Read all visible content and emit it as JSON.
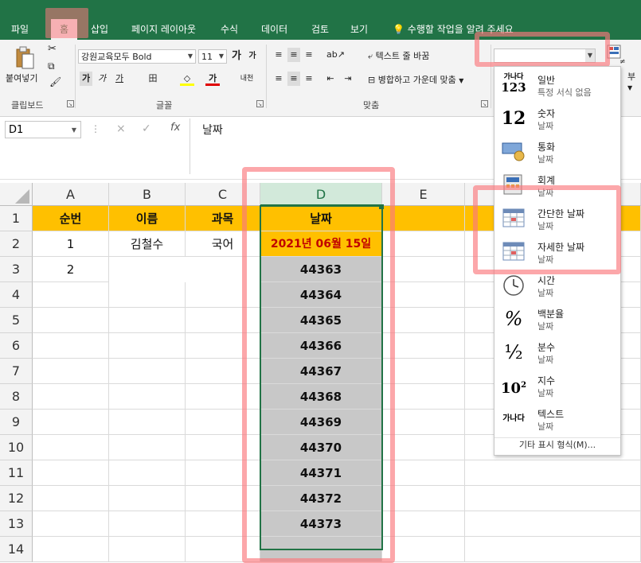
{
  "ribbon_tabs": [
    "파일",
    "홈",
    "삽입",
    "페이지 레이아웃",
    "수식",
    "데이터",
    "검토",
    "보기"
  ],
  "tell_me": "수행할 작업을 알려 주세요",
  "clipboard": {
    "paste_label": "붙여넣기",
    "group_label": "클립보드"
  },
  "font": {
    "name": "강원교육모두 Bold",
    "size": "11",
    "grow": "가",
    "shrink": "가",
    "bold": "가",
    "italic": "가",
    "underline": "가",
    "border": "田",
    "fill": "◇",
    "font_color": "가",
    "phonetic": "내천",
    "group_label": "글꼴"
  },
  "alignment": {
    "wrap_text": "텍스트 줄 바꿈",
    "merge_center": "병합하고 가운데 맞춤",
    "group_label": "맞춤"
  },
  "number_format": {
    "value": ""
  },
  "formula_bar": {
    "name_box": "D1",
    "cancel": "×",
    "enter": "✓",
    "fx": "fx",
    "content": "날짜"
  },
  "columns": [
    "A",
    "B",
    "C",
    "D",
    "E"
  ],
  "rows": [
    "1",
    "2",
    "3",
    "4",
    "5",
    "6",
    "7",
    "8",
    "9",
    "10",
    "11",
    "12",
    "13",
    "14"
  ],
  "header_row": {
    "a": "순번",
    "b": "이름",
    "c": "과목",
    "d": "날짜"
  },
  "row2": {
    "a": "1",
    "b": "김철수",
    "c": "국어",
    "d": "2021년 06월 15일"
  },
  "row3": {
    "a": "2"
  },
  "d_values": [
    "44363",
    "44364",
    "44365",
    "44366",
    "44367",
    "44368",
    "44369",
    "44370",
    "44371",
    "44372",
    "44373"
  ],
  "format_menu": {
    "items": [
      {
        "icon": "가나다 123",
        "name": "일반",
        "sub": "특정 서식 없음"
      },
      {
        "icon": "12",
        "name": "숫자",
        "sub": "날짜"
      },
      {
        "icon": "currency",
        "name": "통화",
        "sub": "날짜"
      },
      {
        "icon": "accounting",
        "name": "회계",
        "sub": "날짜"
      },
      {
        "icon": "calendar",
        "name": "간단한 날짜",
        "sub": "날짜"
      },
      {
        "icon": "calendar",
        "name": "자세한 날짜",
        "sub": "날짜"
      },
      {
        "icon": "clock",
        "name": "시간",
        "sub": "날짜"
      },
      {
        "icon": "%",
        "name": "백분율",
        "sub": "날짜"
      },
      {
        "icon": "½",
        "name": "분수",
        "sub": "날짜"
      },
      {
        "icon": "10²",
        "name": "지수",
        "sub": "날짜"
      },
      {
        "icon": "가나다",
        "name": "텍스트",
        "sub": "날짜"
      }
    ],
    "more": "기타 표시 형식(M)..."
  },
  "colors": {
    "excel_green": "#217346",
    "header_fill": "#ffc000",
    "date_cell_fill": "#ffc000",
    "date_text": "#c00000",
    "selection_fill": "#c8c8c8",
    "highlight": "#fa787d"
  }
}
